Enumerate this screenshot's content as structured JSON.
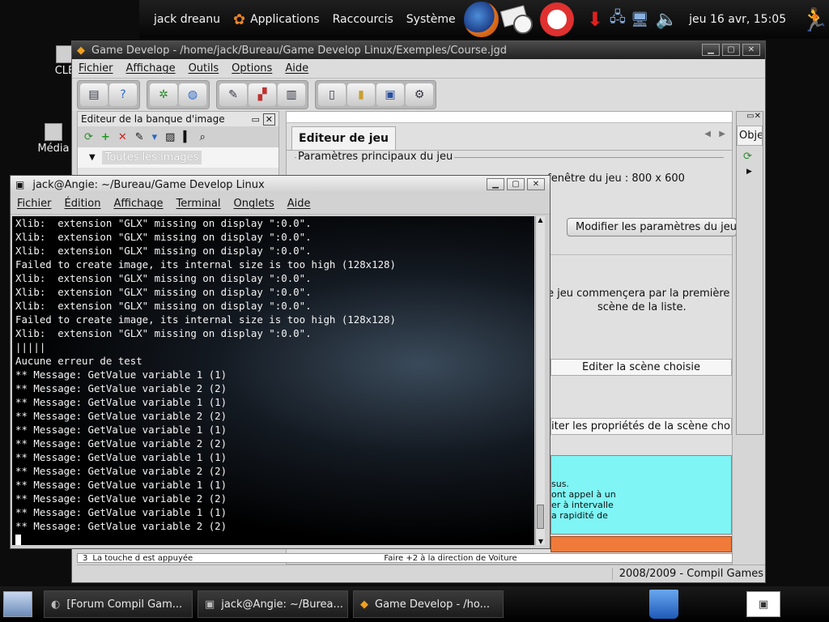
{
  "topbar": {
    "user": "jack dreanu",
    "menu_applications": "Applications",
    "menu_shortcuts": "Raccourcis",
    "menu_system": "Système",
    "clock": "jeu 16 avr, 15:05"
  },
  "desktop": {
    "icons": [
      {
        "label": "CLE"
      },
      {
        "label": "Média"
      }
    ]
  },
  "game_window": {
    "title": "Game Develop - /home/jack/Bureau/Game Develop Linux/Exemples/Course.jgd",
    "menu": [
      "Fichier",
      "Affichage",
      "Outils",
      "Options",
      "Aide"
    ],
    "image_bank_title": "Editeur de la banque d'image",
    "all_images": "Toutes les images",
    "tab_game_editor": "Editeur de jeu",
    "params_section": "Paramètres principaux du jeu",
    "window_size_text": "e fenêtre du jeu : 800 x 600",
    "modify_params_button": "Modifier les paramètres du jeu",
    "scene_text_line1": "e jeu commençera par la première",
    "scene_text_line2": "scène de la liste.",
    "edit_scene_button": "Editer la scène choisie",
    "edit_scene_props_button": "iter les propriétés de la scène chois",
    "objects_tab": "Obje",
    "info_lines": [
      "sus.",
      "ont appel à un",
      "er à intervalle",
      "a rapidité de"
    ],
    "event_row_number": "3",
    "event_condition": "La touche d est appuyée",
    "event_action": "Faire +2 à la direction de Voiture",
    "status": "2008/2009 - Compil Games"
  },
  "terminal": {
    "title": "jack@Angie: ~/Bureau/Game Develop Linux",
    "menu": [
      "Fichier",
      "Édition",
      "Affichage",
      "Terminal",
      "Onglets",
      "Aide"
    ],
    "lines": [
      "Xlib:  extension \"GLX\" missing on display \":0.0\".",
      "Xlib:  extension \"GLX\" missing on display \":0.0\".",
      "Xlib:  extension \"GLX\" missing on display \":0.0\".",
      "Failed to create image, its internal size is too high (128x128)",
      "Xlib:  extension \"GLX\" missing on display \":0.0\".",
      "Xlib:  extension \"GLX\" missing on display \":0.0\".",
      "Xlib:  extension \"GLX\" missing on display \":0.0\".",
      "Failed to create image, its internal size is too high (128x128)",
      "Xlib:  extension \"GLX\" missing on display \":0.0\".",
      "|||||",
      "Aucune erreur de test",
      "** Message: GetValue variable 1 (1)",
      "** Message: GetValue variable 2 (2)",
      "** Message: GetValue variable 1 (1)",
      "** Message: GetValue variable 2 (2)",
      "** Message: GetValue variable 1 (1)",
      "** Message: GetValue variable 2 (2)",
      "** Message: GetValue variable 1 (1)",
      "** Message: GetValue variable 2 (2)",
      "** Message: GetValue variable 1 (1)",
      "** Message: GetValue variable 2 (2)",
      "** Message: GetValue variable 1 (1)",
      "** Message: GetValue variable 2 (2)"
    ]
  },
  "taskbar": {
    "tasks": [
      {
        "label": "[Forum Compil Gam..."
      },
      {
        "label": "jack@Angie: ~/Burea..."
      },
      {
        "label": "Game Develop - /ho..."
      }
    ]
  },
  "colors": {
    "terminal_bg": "#000000",
    "info_panel_bg": "#7ff5f5",
    "orange_bar": "#f07a3a",
    "accent_blue": "#2a66c8"
  },
  "icons": {
    "firefox": "firefox-icon",
    "mail": "mail-icon",
    "help": "lifebuoy-icon",
    "update": "update-arrow-icon",
    "network": "network-icon",
    "volume": "volume-icon",
    "logout": "running-man-icon",
    "trash": "trash-icon"
  }
}
